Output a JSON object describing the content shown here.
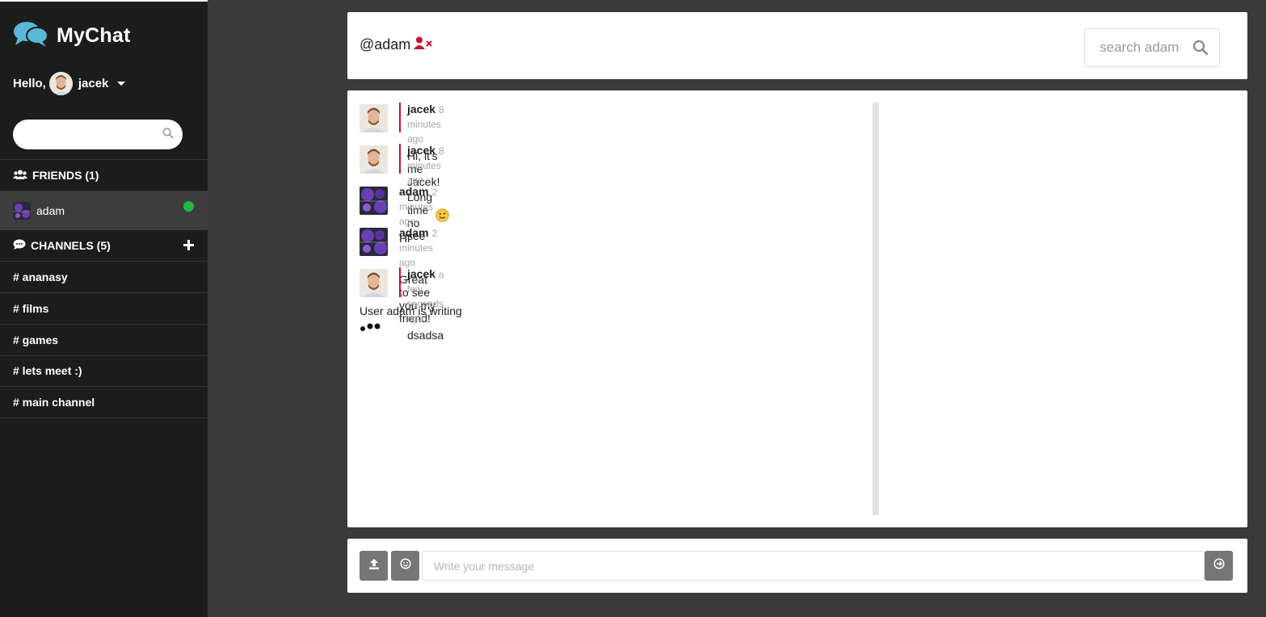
{
  "app": {
    "title": "MyChat",
    "greeting": "Hello,",
    "username": "jacek"
  },
  "sidebar": {
    "friends_label": "FRIENDS (1)",
    "friends": [
      {
        "name": "adam",
        "status": "online"
      }
    ],
    "channels_label": "CHANNELS (5)",
    "channels": [
      "# ananasy",
      "# films",
      "# games",
      "# lets meet :)",
      "# main channel"
    ]
  },
  "header": {
    "title": "@adam",
    "search_placeholder": "search adam"
  },
  "messages": [
    {
      "author": "jacek",
      "time": "8 minutes ago",
      "text": "Hi, it's me Jacek!"
    },
    {
      "author": "jacek",
      "time": "8 minutes ago",
      "text": "Long time no see",
      "emoji": "😉"
    },
    {
      "author": "adam",
      "time": "2 minutes ago",
      "text": "Hi"
    },
    {
      "author": "adam",
      "time": "2 minutes ago",
      "text": "Great to see you my friend!"
    },
    {
      "author": "jacek",
      "time": "a few seconds ago",
      "text": "dsadsa"
    }
  ],
  "typing": "User adam is writing",
  "composer": {
    "placeholder": "Write your message"
  },
  "colors": {
    "sidebar_bg": "#1c1c1c",
    "app_bg": "#3a3a3a",
    "accent_red": "#c8102e",
    "online_green": "#21ba45",
    "brand_blue": "#5bb7d6"
  },
  "icons": [
    "chat-bubbles-icon",
    "caret-down-icon",
    "search-icon",
    "users-icon",
    "comment-icon",
    "plus-icon",
    "user-remove-icon",
    "upload-icon",
    "smile-icon",
    "send-icon"
  ]
}
